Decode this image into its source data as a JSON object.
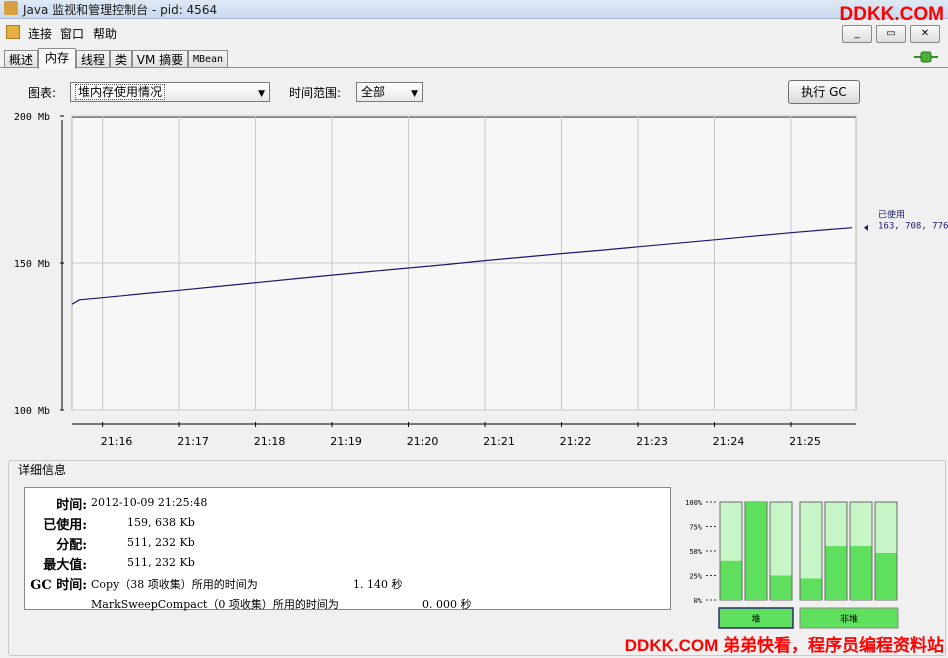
{
  "window": {
    "title": "Java 监视和管理控制台 - pid: 4564"
  },
  "watermark": {
    "top": "DDKK.COM",
    "bottom": "DDKK.COM 弟弟快看，程序员编程资料站"
  },
  "menu": {
    "items": [
      "连接",
      "窗口",
      "帮助"
    ]
  },
  "window_buttons": [
    "_",
    "▭",
    "✕"
  ],
  "tabs": [
    "概述",
    "内存",
    "线程",
    "类",
    "VM 摘要",
    "MBean"
  ],
  "active_tab": "内存",
  "toolbar": {
    "chart_label": "图表:",
    "chart_value": "堆内存使用情况",
    "range_label": "时间范围:",
    "range_value": "全部",
    "gc_button": "执行 GC"
  },
  "chart_data": {
    "type": "line",
    "ylim": [
      100,
      200
    ],
    "yticks": [
      "200 Mb",
      "150 Mb",
      "100 Mb"
    ],
    "xticks": [
      "21:16",
      "21:17",
      "21:18",
      "21:19",
      "21:20",
      "21:21",
      "21:22",
      "21:23",
      "21:24",
      "21:25"
    ],
    "series": [
      {
        "name": "已使用",
        "color": "#1a1a6e",
        "x_minutes": [
          15.6,
          15.7,
          16.0,
          16.5,
          17.0,
          17.5,
          18.0,
          18.5,
          19.0,
          19.5,
          20.0,
          20.5,
          21.0,
          21.5,
          22.0,
          22.5,
          23.0,
          23.5,
          24.0,
          24.5,
          25.0,
          25.5,
          25.8
        ],
        "values": [
          136.0,
          137.5,
          138.2,
          139.5,
          140.7,
          142.0,
          143.3,
          144.6,
          145.9,
          147.1,
          148.3,
          149.5,
          150.8,
          152.0,
          153.2,
          154.3,
          155.5,
          156.7,
          157.9,
          159.1,
          160.3,
          161.4,
          162.0
        ]
      }
    ],
    "last_value_label": "已使用",
    "last_value": "163, 708, 776"
  },
  "details": {
    "title": "详细信息",
    "rows": [
      {
        "key": "时间:",
        "value": "2012-10-09 21:25:48"
      },
      {
        "key": "已使用:",
        "value": "159, 638 Kb"
      },
      {
        "key": "分配:",
        "value": "511, 232 Kb"
      },
      {
        "key": "最大值:",
        "value": "511, 232 Kb"
      },
      {
        "key": "GC 时间:",
        "value": "Copy（38 项收集）所用的时间为",
        "extra": "1. 140 秒"
      },
      {
        "key": "",
        "value": "MarkSweepCompact（0 项收集）所用的时间为",
        "extra": "0. 000 秒"
      }
    ]
  },
  "pool_bars": {
    "yticks": [
      "100%",
      "75%",
      "50%",
      "25%",
      "0%"
    ],
    "heap_used": [
      0.4,
      1.0,
      0.25
    ],
    "nonheap_used": [
      0.22,
      0.55,
      0.55,
      0.48
    ],
    "heap_label": "堆",
    "nonheap_label": "非堆",
    "fill_color": "#5ee05e",
    "bg_color": "#c8f5c8"
  }
}
